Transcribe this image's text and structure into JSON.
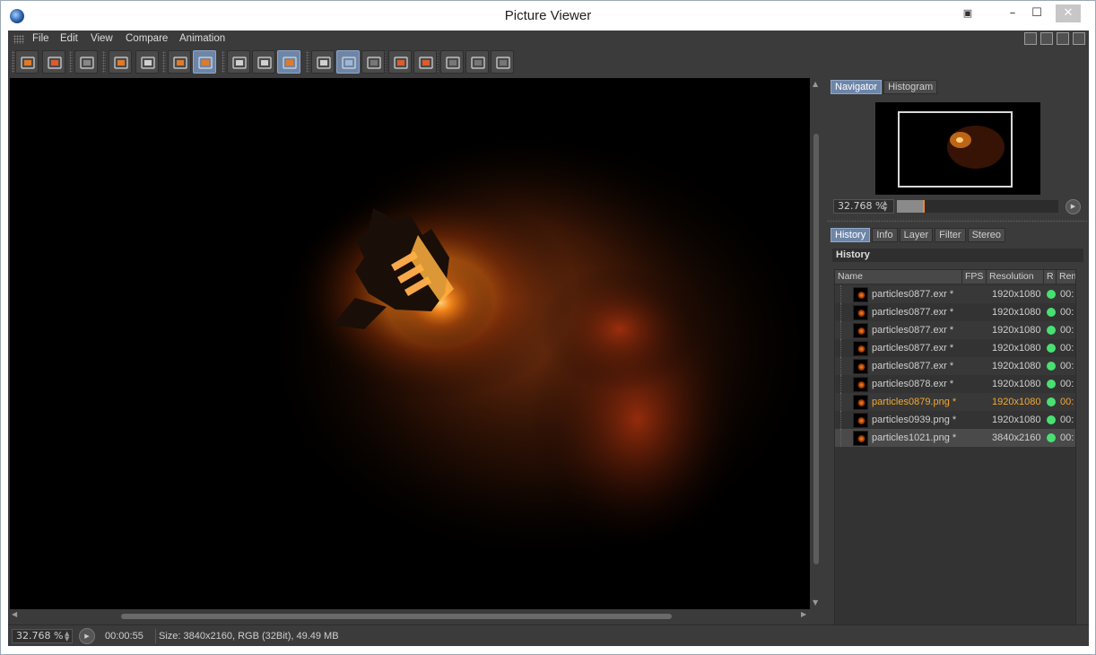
{
  "window": {
    "title": "Picture Viewer",
    "controls": {
      "minimize": "–",
      "maximize": "☐",
      "close": "✕"
    }
  },
  "menu": {
    "items": [
      "File",
      "Edit",
      "View",
      "Compare",
      "Animation"
    ]
  },
  "toolbar": {
    "buttons": [
      {
        "icon": "open-folder-icon",
        "active": false
      },
      {
        "icon": "save-icon",
        "active": false
      },
      {
        "icon": "render-settings-icon",
        "active": false
      },
      {
        "icon": "fit-to-view-icon",
        "active": false
      },
      {
        "icon": "user-download-icon",
        "active": false
      },
      {
        "icon": "copy-layers-icon",
        "active": false
      },
      {
        "icon": "layer-stack-icon",
        "active": true
      },
      {
        "icon": "view-single-icon",
        "active": false
      },
      {
        "icon": "view-eye-icon",
        "active": false
      },
      {
        "icon": "compare-circles-icon",
        "active": true
      },
      {
        "icon": "ab-split-icon",
        "active": false
      },
      {
        "icon": "ab-overlay-icon",
        "active": true
      },
      {
        "icon": "ab-swap-icon",
        "active": false
      },
      {
        "icon": "set-a-icon",
        "active": false
      },
      {
        "icon": "set-b-icon",
        "active": false
      },
      {
        "icon": "compare-grid-1-icon",
        "active": false
      },
      {
        "icon": "compare-grid-2-icon",
        "active": false
      },
      {
        "icon": "compare-grid-3-icon",
        "active": false
      }
    ]
  },
  "navigator": {
    "tabs": [
      {
        "label": "Navigator",
        "active": true
      },
      {
        "label": "Histogram",
        "active": false
      }
    ],
    "zoom": "32.768 %",
    "zoom_level": 0.16
  },
  "info_panel": {
    "tabs": [
      {
        "label": "History",
        "active": true
      },
      {
        "label": "Info",
        "active": false
      },
      {
        "label": "Layer",
        "active": false
      },
      {
        "label": "Filter",
        "active": false
      },
      {
        "label": "Stereo",
        "active": false
      }
    ],
    "section_title": "History",
    "columns": [
      "Name",
      "FPS",
      "Resolution",
      "R",
      "Ren"
    ],
    "rows": [
      {
        "name": "particles0877.exr *",
        "resolution": "1920x1080",
        "render": "00:",
        "current": false,
        "selected": false
      },
      {
        "name": "particles0877.exr *",
        "resolution": "1920x1080",
        "render": "00:",
        "current": false,
        "selected": false
      },
      {
        "name": "particles0877.exr *",
        "resolution": "1920x1080",
        "render": "00:",
        "current": false,
        "selected": false
      },
      {
        "name": "particles0877.exr *",
        "resolution": "1920x1080",
        "render": "00:",
        "current": false,
        "selected": false
      },
      {
        "name": "particles0877.exr *",
        "resolution": "1920x1080",
        "render": "00:",
        "current": false,
        "selected": false
      },
      {
        "name": "particles0878.exr *",
        "resolution": "1920x1080",
        "render": "00:",
        "current": false,
        "selected": false
      },
      {
        "name": "particles0879.png *",
        "resolution": "1920x1080",
        "render": "00:",
        "current": true,
        "selected": false
      },
      {
        "name": "particles0939.png *",
        "resolution": "1920x1080",
        "render": "00:",
        "current": false,
        "selected": false
      },
      {
        "name": "particles1021.png *",
        "resolution": "3840x2160",
        "render": "00:",
        "current": false,
        "selected": true
      }
    ]
  },
  "statusbar": {
    "zoom": "32.768 %",
    "time": "00:00:55",
    "info": "Size: 3840x2160, RGB (32Bit), 49.49 MB"
  },
  "colors": {
    "accent": "#6d86a8",
    "current_item": "#f3a833",
    "status_ok": "#49e072",
    "panel_bg": "#3b3b3b"
  }
}
